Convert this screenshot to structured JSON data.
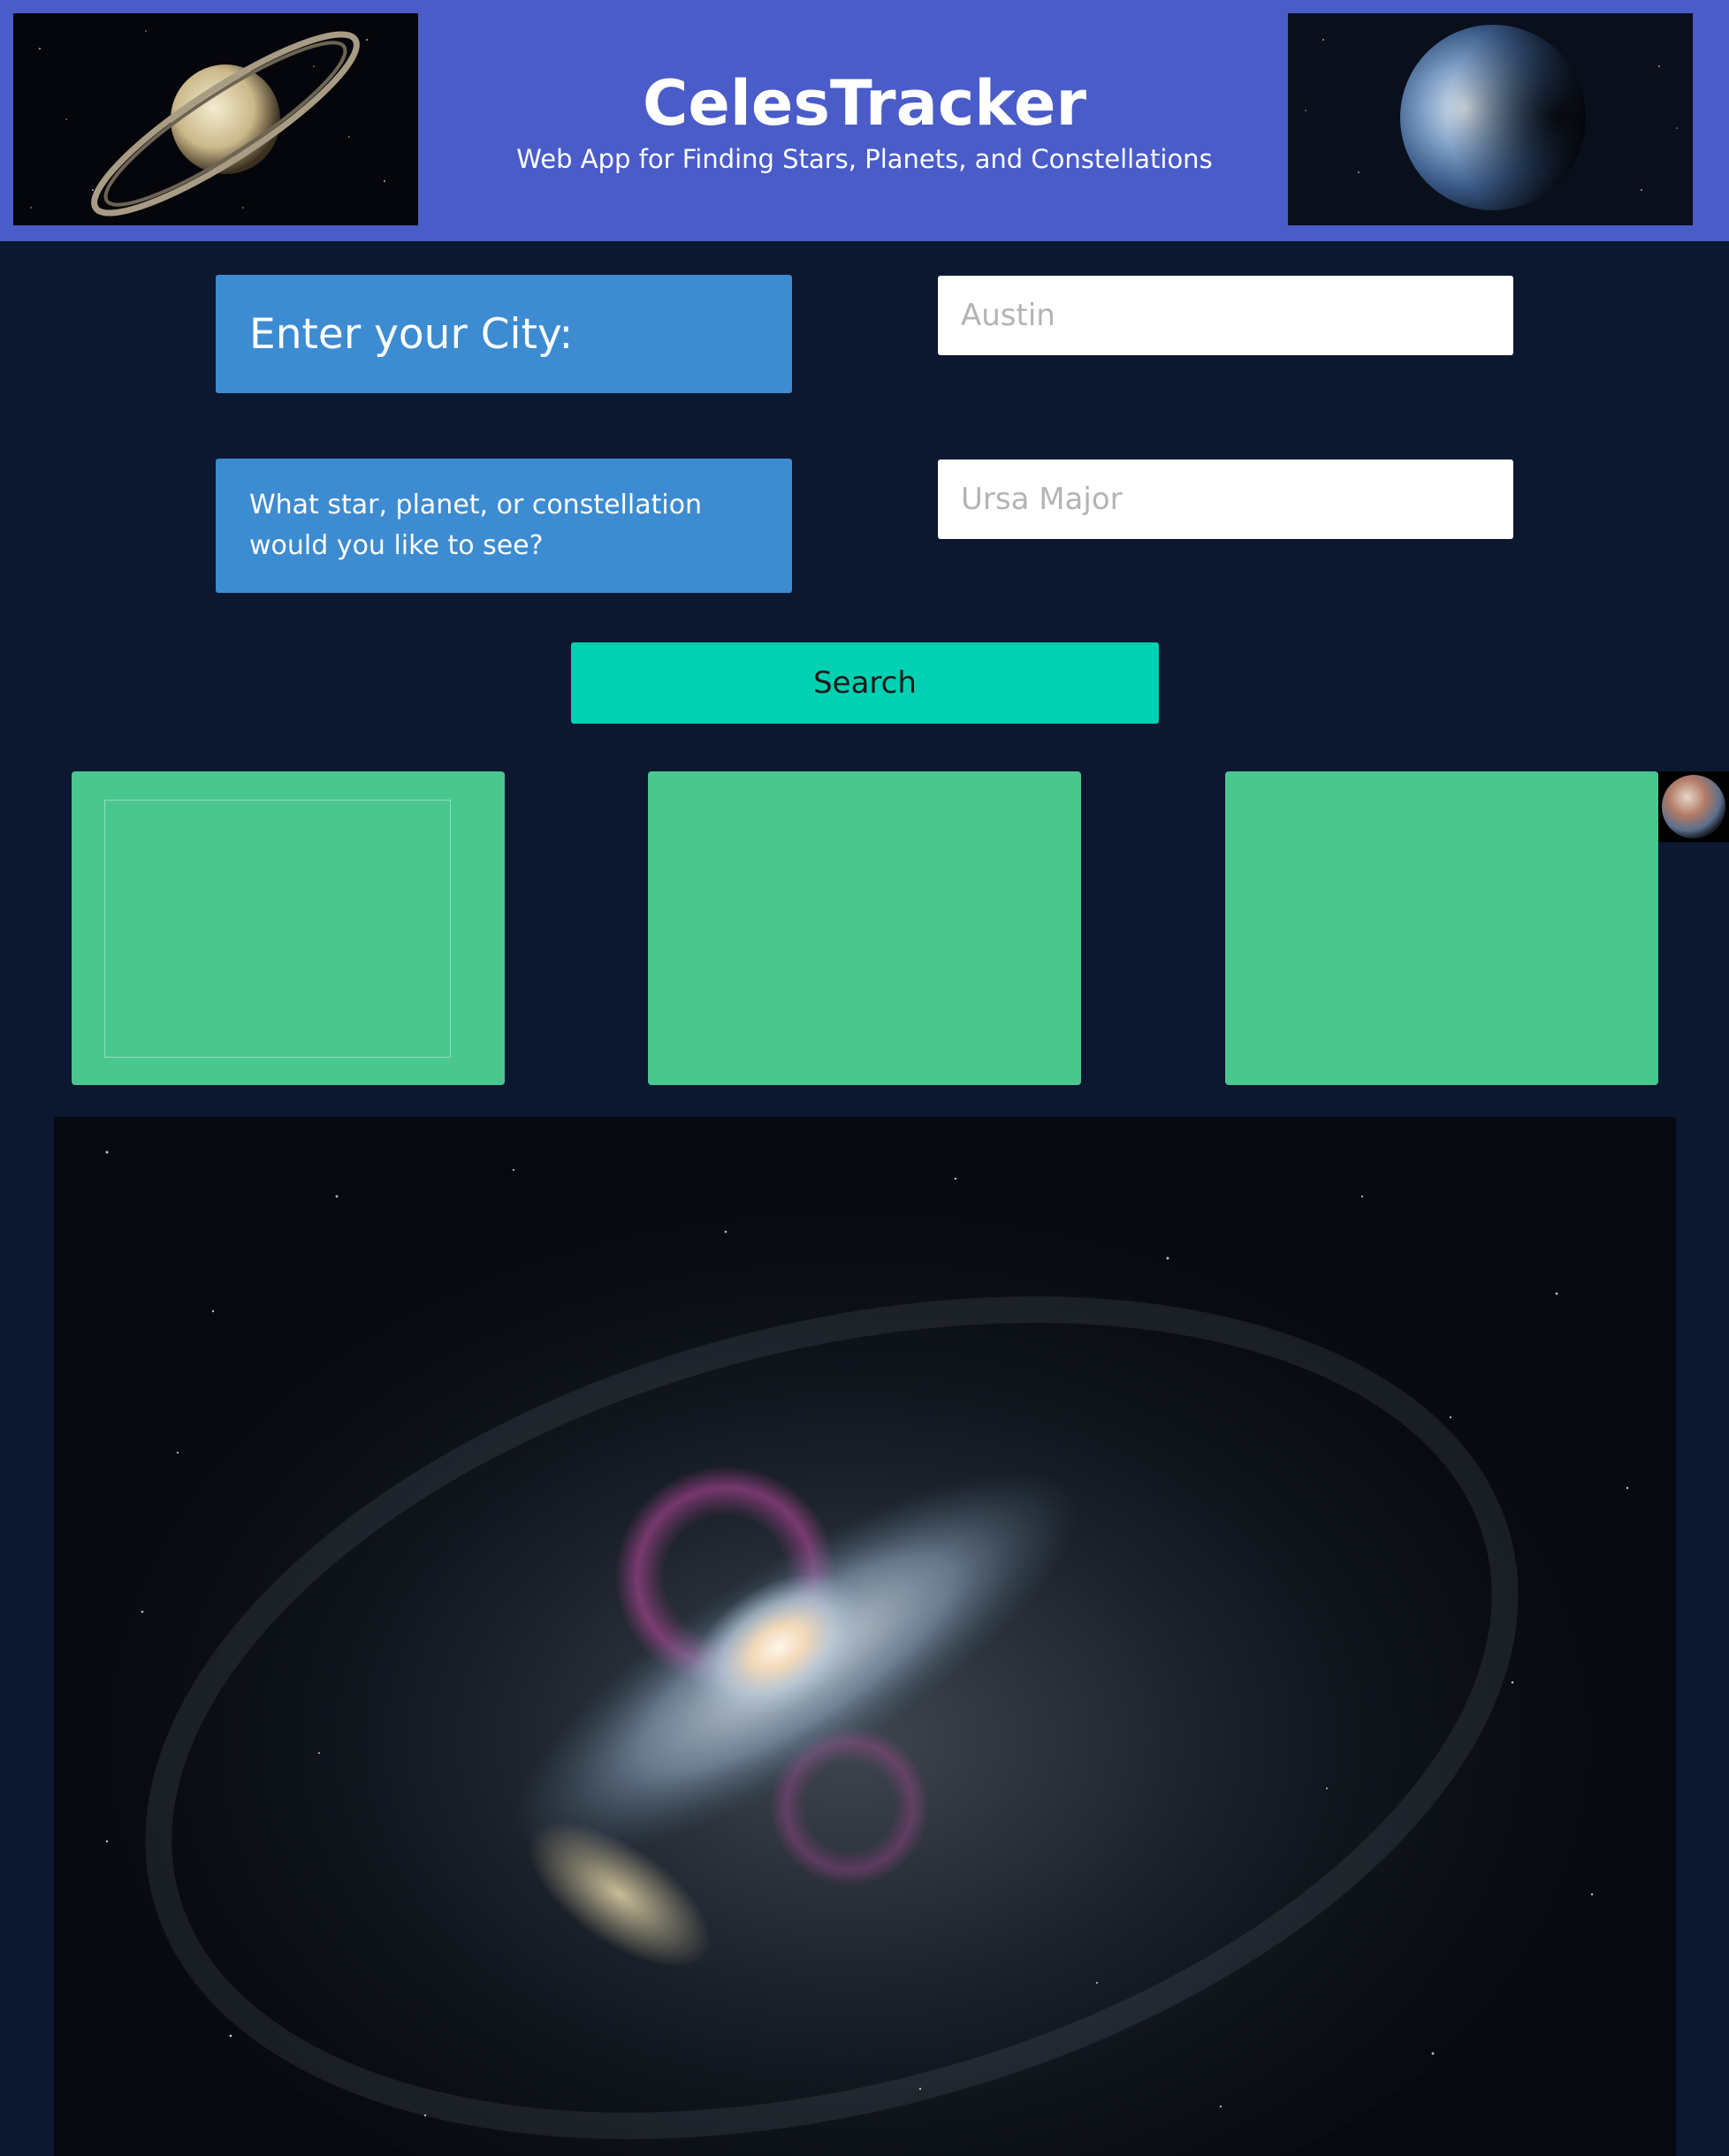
{
  "header": {
    "title": "CelesTracker",
    "subtitle": "Web App for Finding Stars, Planets, and Constellations",
    "left_image": "saturn-image",
    "right_image": "earth-like-planet-image"
  },
  "form": {
    "city_label": "Enter your City:",
    "city_placeholder": "Austin",
    "object_label": "What star, planet, or constellation would you like to see?",
    "object_placeholder": "Ursa Major",
    "search_label": "Search"
  },
  "results": {
    "cards": [
      {
        "name": "result-card-1"
      },
      {
        "name": "result-card-2"
      },
      {
        "name": "result-card-3"
      }
    ],
    "side_image": "planet-thumbnail"
  },
  "footer_image": "galaxy-image",
  "colors": {
    "header_bg": "#4a5cc8",
    "page_bg": "#0c1730",
    "label_bg": "#3d8bd0",
    "button_bg": "#00d1b2",
    "card_bg": "#4ac78f"
  }
}
